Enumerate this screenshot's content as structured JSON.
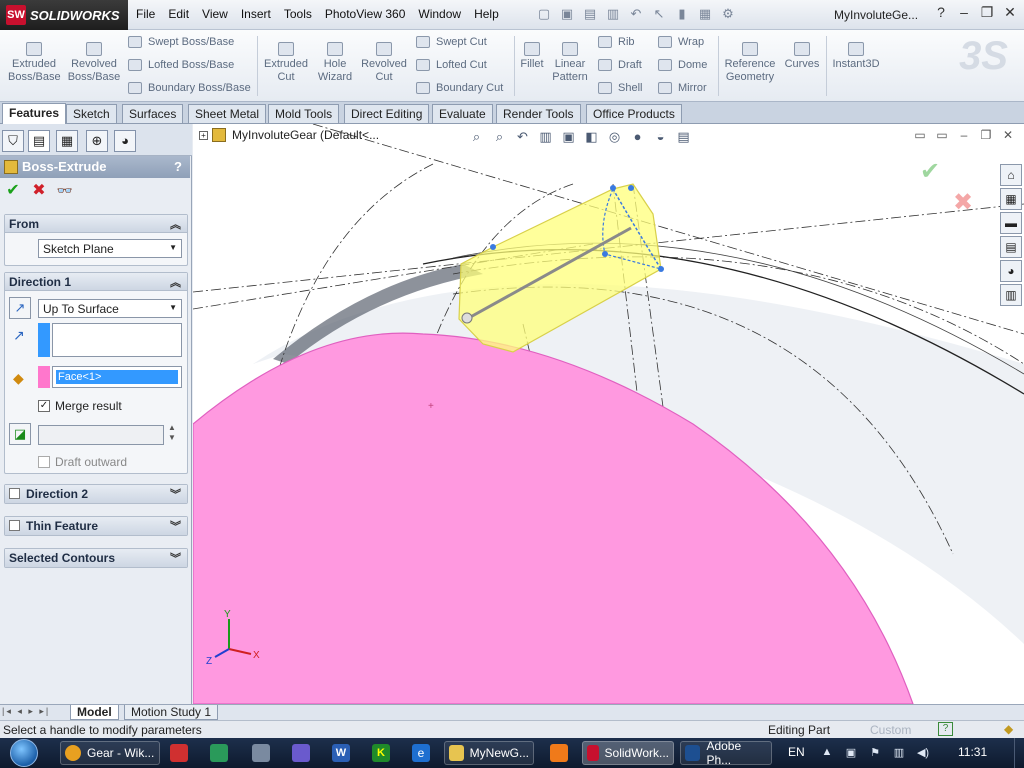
{
  "app": {
    "logo_text": "SOLIDWORKS",
    "logo_mark": "SW",
    "doc_title": "MyInvoluteGe..."
  },
  "menu": [
    "File",
    "Edit",
    "View",
    "Insert",
    "Tools",
    "PhotoView 360",
    "Window",
    "Help"
  ],
  "commands": {
    "extruded_boss": "Extruded Boss/Base",
    "revolved_boss": "Revolved Boss/Base",
    "swept_boss": "Swept Boss/Base",
    "lofted_boss": "Lofted Boss/Base",
    "boundary_boss": "Boundary Boss/Base",
    "extruded_cut": "Extruded Cut",
    "hole_wizard": "Hole Wizard",
    "revolved_cut": "Revolved Cut",
    "swept_cut": "Swept Cut",
    "lofted_cut": "Lofted Cut",
    "boundary_cut": "Boundary Cut",
    "fillet": "Fillet",
    "linear_pattern": "Linear Pattern",
    "rib": "Rib",
    "draft": "Draft",
    "shell": "Shell",
    "wrap": "Wrap",
    "dome": "Dome",
    "mirror": "Mirror",
    "reference_geometry": "Reference Geometry",
    "curves": "Curves",
    "instant3d": "Instant3D"
  },
  "tabs": [
    "Features",
    "Sketch",
    "Surfaces",
    "Sheet Metal",
    "Mold Tools",
    "Direct Editing",
    "Evaluate",
    "Render Tools",
    "Office Products"
  ],
  "property_manager": {
    "title": "Boss-Extrude",
    "help": "?",
    "from": {
      "label": "From",
      "value": "Sketch Plane"
    },
    "direction1": {
      "label": "Direction 1",
      "end_condition": "Up To Surface",
      "face_value": "Face<1>",
      "merge_label": "Merge result",
      "merge_checked": true,
      "draft_label": "Draft outward"
    },
    "direction2": {
      "label": "Direction 2"
    },
    "thin_feature": {
      "label": "Thin Feature"
    },
    "selected_contours": {
      "label": "Selected Contours"
    }
  },
  "viewport": {
    "tree_root": "MyInvoluteGear  (Default<...",
    "triad": {
      "x": "X",
      "y": "Y",
      "z": "Z"
    }
  },
  "bottom_tabs": [
    "Model",
    "Motion Study 1"
  ],
  "status": {
    "message": "Select a handle to modify parameters",
    "mode": "Editing Part",
    "custom": "Custom"
  },
  "taskbar": {
    "items": [
      {
        "label": "Gear - Wik...",
        "color": "#e8a020"
      },
      {
        "label": "MyNewG...",
        "color": "#e7c450"
      },
      {
        "label": "SolidWork...",
        "color": "#c8102e"
      },
      {
        "label": "Adobe Ph...",
        "color": "#1d4f91"
      }
    ],
    "lang": "EN",
    "clock": "11:31"
  },
  "colors": {
    "pink_face": "#ff99e0",
    "yellow_extrude": "#ffff7a",
    "accent_blue": "#3399ff"
  }
}
